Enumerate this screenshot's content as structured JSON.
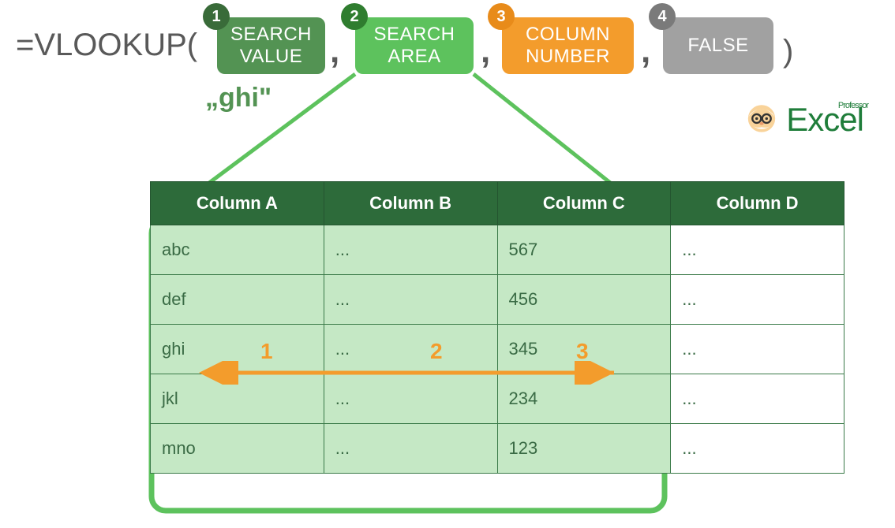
{
  "formula": {
    "func_prefix": "=VLOOKUP(",
    "comma": ",",
    "close": ")",
    "args": {
      "a1": {
        "badge": "1",
        "line1": "SEARCH",
        "line2": "VALUE",
        "example": "„ghi\""
      },
      "a2": {
        "badge": "2",
        "line1": "SEARCH",
        "line2": "AREA"
      },
      "a3": {
        "badge": "3",
        "line1": "COLUMN",
        "line2": "NUMBER"
      },
      "a4": {
        "badge": "4",
        "line1": "FALSE",
        "line2": ""
      }
    }
  },
  "logo": {
    "sup": "Professor",
    "main": "Excel"
  },
  "table": {
    "headers": [
      "Column A",
      "Column B",
      "Column C",
      "Column D"
    ],
    "rows": [
      [
        "abc",
        "...",
        "567",
        "..."
      ],
      [
        "def",
        "...",
        "456",
        "..."
      ],
      [
        "ghi",
        "...",
        "345",
        "..."
      ],
      [
        "jkl",
        "...",
        "234",
        "..."
      ],
      [
        "mno",
        "...",
        "123",
        "..."
      ]
    ],
    "highlight_cols": 3,
    "arrow_row_index": 2
  },
  "col_numbers": {
    "n1": "1",
    "n2": "2",
    "n3": "3"
  },
  "colors": {
    "arg1_bg": "#539353",
    "arg2_bg": "#5dc25d",
    "arg3_bg": "#f39c2c",
    "arg4_bg": "#a1a1a1",
    "highlight_border": "#5dc25d",
    "table_header_bg": "#2d6b3a",
    "orange": "#f39c2c"
  }
}
